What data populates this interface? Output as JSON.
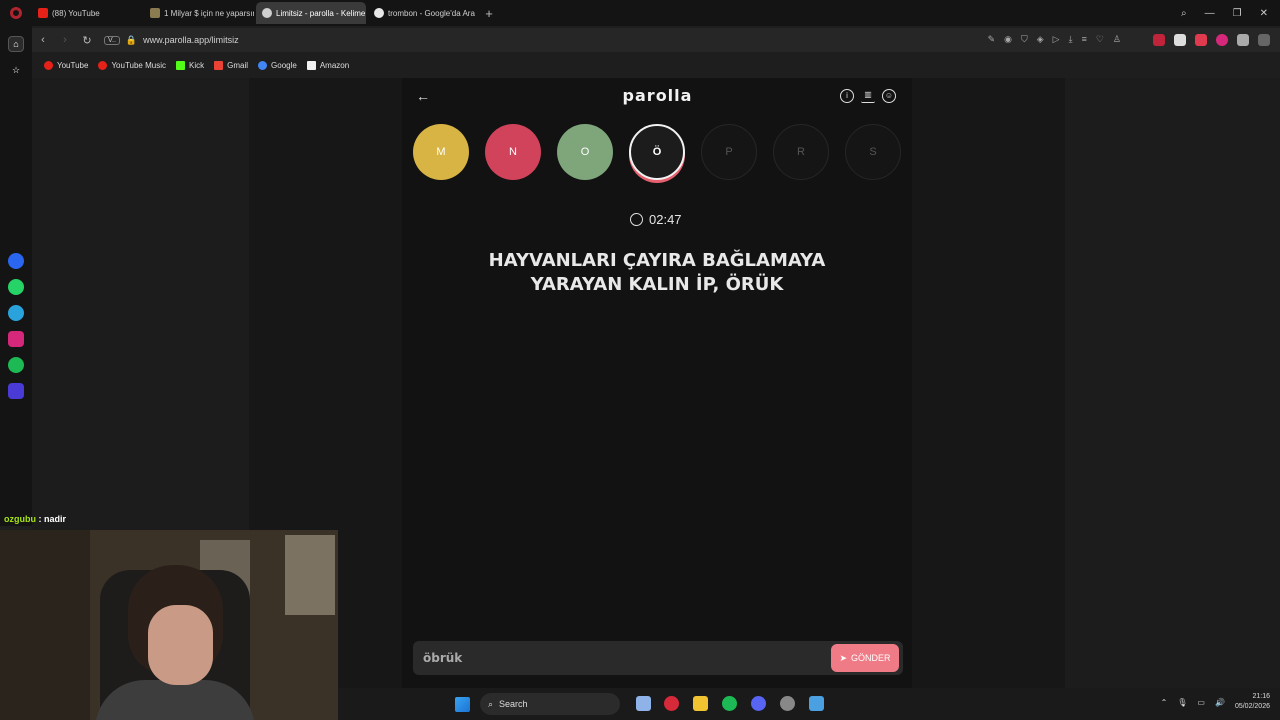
{
  "browser": {
    "tabs": [
      {
        "label": "(88) YouTube",
        "color": "#e62117"
      },
      {
        "label": "1 Milyar $ için ne yaparsın",
        "color": "#8b7b50"
      },
      {
        "label": "Limitsiz - parolla - Kelime",
        "color": "#cfcfcf",
        "active": true
      },
      {
        "label": "trombon - Google'da Ara",
        "color": "#e8e8e8"
      }
    ],
    "new_tab": "+",
    "url": "www.parolla.app/limitsiz",
    "vbadge": "V..",
    "bookmarks": [
      {
        "label": "YouTube",
        "color": "#e62117"
      },
      {
        "label": "YouTube Music",
        "color": "#e62117"
      },
      {
        "label": "Kick",
        "color": "#53fc18"
      },
      {
        "label": "Gmail",
        "color": "#ea4335"
      },
      {
        "label": "Google",
        "color": "#4285f4"
      },
      {
        "label": "Amazon",
        "color": "#f2f2f2"
      }
    ]
  },
  "game": {
    "logo": "parolla",
    "letters": [
      {
        "char": "M",
        "state": "correct-yellow",
        "color": "#d7b443"
      },
      {
        "char": "N",
        "state": "wrong",
        "color": "#d1425b"
      },
      {
        "char": "O",
        "state": "correct",
        "color": "#7fa57b"
      },
      {
        "char": "Ö",
        "state": "current",
        "color": "#1c1c1c"
      },
      {
        "char": "P",
        "state": "pending",
        "color": "#151515"
      },
      {
        "char": "R",
        "state": "pending",
        "color": "#151515"
      },
      {
        "char": "S",
        "state": "pending",
        "color": "#151515"
      }
    ],
    "timer": "02:47",
    "question_line1": "HAYVANLARI ÇAYIRA BAĞLAMAYA",
    "question_line2": "YARAYAN KALIN İP, ÖRÜK",
    "answer_value": "öbrük",
    "send_label": "GÖNDER"
  },
  "stream": {
    "chat_user": "ozgubu",
    "chat_message": ": nadir"
  },
  "taskbar": {
    "search_label": "Search",
    "time": "21:16",
    "date": "05/02/2026"
  }
}
